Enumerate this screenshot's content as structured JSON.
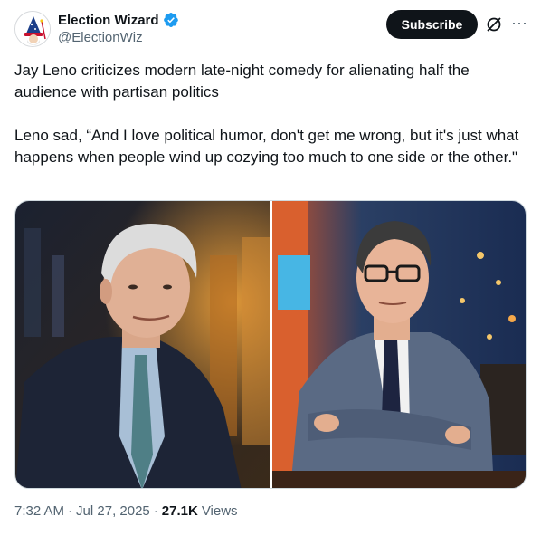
{
  "author": {
    "display_name": "Election Wizard",
    "handle": "@ElectionWiz",
    "verified_icon": "verified-badge-icon",
    "avatar_icon": "wizard-avatar-icon"
  },
  "actions": {
    "subscribe_label": "Subscribe",
    "grok_icon": "grok-icon",
    "more_icon": "more-options-icon",
    "more_label": "···"
  },
  "tweet": {
    "paragraph_1": "Jay Leno criticizes modern late-night comedy for alienating half the audience with partisan politics",
    "paragraph_2": "Leno sad, “And I love political humor, don't get me wrong, but it's just what happens when people wind up cozying too much to one side or the other.\""
  },
  "media": {
    "images": [
      {
        "name": "photo-jay-leno",
        "description_icon": "photo"
      },
      {
        "name": "photo-stephen-colbert",
        "description_icon": "photo"
      }
    ]
  },
  "meta": {
    "time": "7:32 AM",
    "sep1": "·",
    "date": "Jul 27, 2025",
    "sep2": "·",
    "views_count": "27.1K",
    "views_label": "Views"
  },
  "colors": {
    "text_primary": "#0f1419",
    "text_secondary": "#536471",
    "verified_blue": "#1d9bf0",
    "subscribe_bg": "#0f1419"
  }
}
